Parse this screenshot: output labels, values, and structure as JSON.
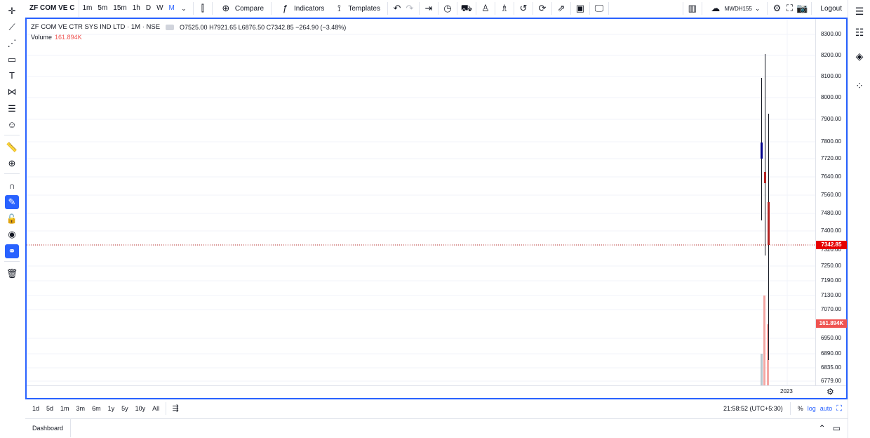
{
  "toolbar": {
    "symbol": "ZF COM VE C",
    "timeframes": [
      "1m",
      "5m",
      "15m",
      "1h",
      "D",
      "W",
      "M"
    ],
    "active_timeframe": "M",
    "compare_label": "Compare",
    "indicators_label": "Indicators",
    "templates_label": "Templates",
    "cloud_label": "MWDH155",
    "logout_label": "Logout"
  },
  "legend": {
    "title": "ZF COM VE CTR SYS IND LTD · 1M · NSE",
    "ohlc": "O7525.00 H7921.65 L6876.50 C7342.85 −264.90 (−3.48%)",
    "volume_label": "Volume",
    "volume_value": "161.894K"
  },
  "price_axis": {
    "ticks": [
      "8300.00",
      "8200.00",
      "8100.00",
      "8000.00",
      "7900.00",
      "7800.00",
      "7720.00",
      "7640.00",
      "7560.00",
      "7480.00",
      "7400.00",
      "7320.00",
      "7250.00",
      "7190.00",
      "7130.00",
      "7070.00",
      "6950.00",
      "6890.00",
      "6835.00",
      "6779.00"
    ],
    "last_price": "7342.85",
    "volume_tag": "161.894K"
  },
  "time_axis": {
    "year_label": "2023"
  },
  "range_bar": {
    "ranges": [
      "1d",
      "5d",
      "1m",
      "3m",
      "6m",
      "1y",
      "5y",
      "10y",
      "All"
    ],
    "clock": "21:58:52 (UTC+5:30)",
    "percent_label": "%",
    "log_label": "log",
    "auto_label": "auto"
  },
  "footer": {
    "dashboard_label": "Dashboard"
  },
  "colors": {
    "accent": "#2962ff",
    "down": "#b22222",
    "up": "#00008b",
    "volume_down": "#f4a6a3",
    "volume_up": "#b8c7cf"
  }
}
